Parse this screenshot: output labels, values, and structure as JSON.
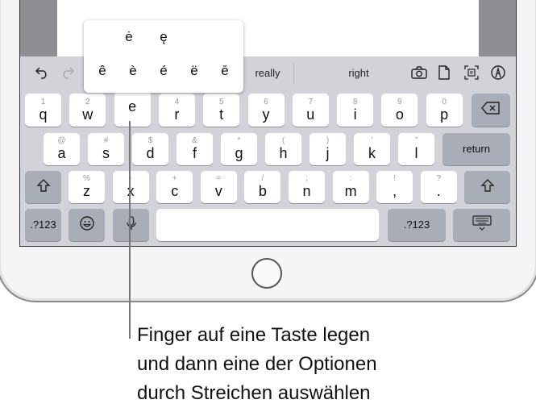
{
  "toolbar": {
    "undo_icon": "undo-arrow-icon",
    "redo_icon": "redo-arrow-icon",
    "suggestions": [
      "really",
      "right"
    ],
    "icons": [
      "camera-icon",
      "document-icon",
      "scan-text-icon",
      "markup-pen-icon"
    ]
  },
  "popup": {
    "row1": [
      "ė",
      "ę"
    ],
    "row2": [
      "ê",
      "è",
      "é",
      "ë",
      "ē"
    ]
  },
  "keyboard": {
    "row1": [
      {
        "k": "q",
        "s": "1"
      },
      {
        "k": "w",
        "s": "2"
      },
      {
        "k": "e",
        "s": ""
      },
      {
        "k": "r",
        "s": "4"
      },
      {
        "k": "t",
        "s": "5"
      },
      {
        "k": "y",
        "s": "6"
      },
      {
        "k": "u",
        "s": "7"
      },
      {
        "k": "i",
        "s": "8"
      },
      {
        "k": "o",
        "s": "9"
      },
      {
        "k": "p",
        "s": "0"
      }
    ],
    "row2": [
      {
        "k": "a",
        "s": "@"
      },
      {
        "k": "s",
        "s": "#"
      },
      {
        "k": "d",
        "s": "$"
      },
      {
        "k": "f",
        "s": "&"
      },
      {
        "k": "g",
        "s": "*"
      },
      {
        "k": "h",
        "s": "("
      },
      {
        "k": "j",
        "s": ")"
      },
      {
        "k": "k",
        "s": "’"
      },
      {
        "k": "l",
        "s": "”"
      }
    ],
    "row3": [
      {
        "k": "z",
        "s": "%"
      },
      {
        "k": "x",
        "s": "-"
      },
      {
        "k": "c",
        "s": "+"
      },
      {
        "k": "v",
        "s": "="
      },
      {
        "k": "b",
        "s": "/"
      },
      {
        "k": "n",
        "s": ";"
      },
      {
        "k": "m",
        "s": ":"
      },
      {
        "k": ",",
        "s": "!"
      },
      {
        "k": ".",
        "s": "?"
      }
    ],
    "pressed_key": "e",
    "return_label": "return",
    "numbers_label": ".?123",
    "space_label": ""
  },
  "caption": {
    "lines": [
      "Finger auf eine Taste legen",
      "und dann eine der Optionen",
      "durch Streichen auswählen"
    ]
  }
}
